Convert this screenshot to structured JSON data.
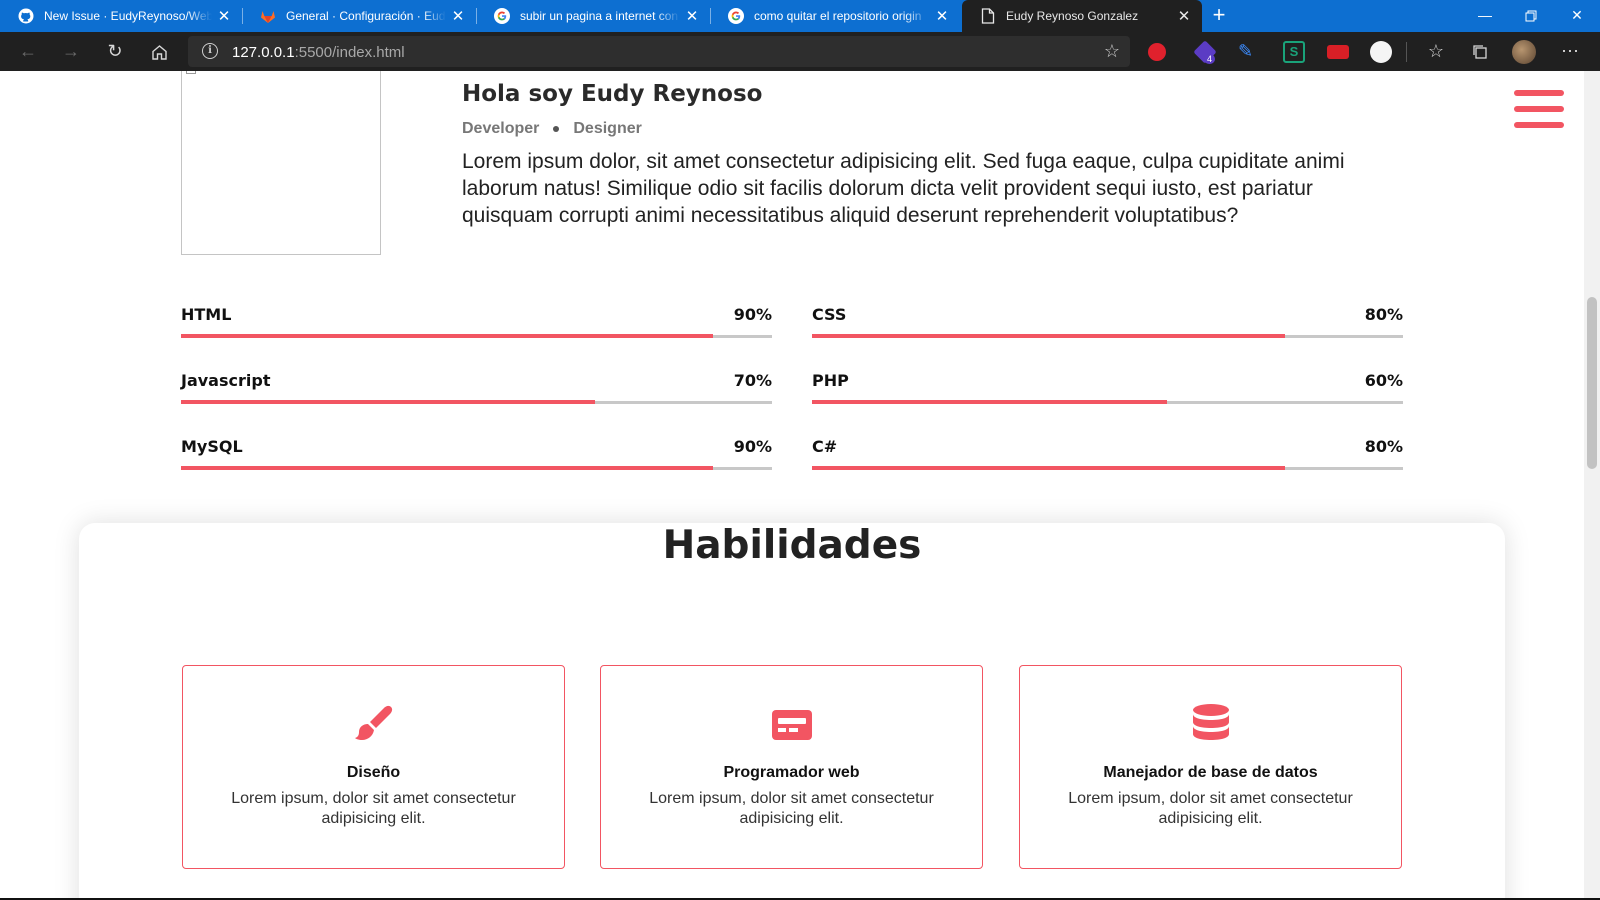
{
  "browser": {
    "tabs": [
      {
        "title": "New Issue · EudyReynoso/Web-p",
        "icon": "github-icon",
        "active": false
      },
      {
        "title": "General · Configuración · Eudy Re",
        "icon": "gitlab-icon",
        "active": false
      },
      {
        "title": "subir un pagina a internet con gi",
        "icon": "google-icon",
        "active": false
      },
      {
        "title": "como quitar el repositorio origin",
        "icon": "google-icon",
        "active": false
      },
      {
        "title": "Eudy Reynoso Gonzalez",
        "icon": "page-icon",
        "active": true
      }
    ],
    "address": {
      "host": "127.0.0.1",
      "rest": ":5500/index.html"
    },
    "extension_badge": "4",
    "colors": {
      "titlebar": "#0d6fd1",
      "toolbar": "#202020"
    }
  },
  "profile": {
    "greeting": "Hola soy Eudy Reynoso",
    "roles": [
      "Developer",
      "Designer"
    ],
    "intro": "Lorem ipsum dolor, sit amet consectetur adipisicing elit. Sed fuga eaque, culpa cupiditate animi laborum natus! Similique odio sit facilis dolorum dicta velit provident sequi iusto, est pariatur quisquam corrupti animi necessitatibus aliquid deserunt reprehenderit voluptatibus?"
  },
  "skills": [
    {
      "name": "HTML",
      "percent_label": "90%",
      "level": 0.9
    },
    {
      "name": "CSS",
      "percent_label": "80%",
      "level": 0.8
    },
    {
      "name": "Javascript",
      "percent_label": "70%",
      "level": 0.7
    },
    {
      "name": "PHP",
      "percent_label": "60%",
      "level": 0.6
    },
    {
      "name": "MySQL",
      "percent_label": "90%",
      "level": 0.9
    },
    {
      "name": "C#",
      "percent_label": "80%",
      "level": 0.8
    }
  ],
  "habilidades": {
    "title": "Habilidades",
    "cards": [
      {
        "icon": "paint-brush-icon",
        "title": "Diseño",
        "text": "Lorem ipsum, dolor sit amet consectetur adipisicing elit."
      },
      {
        "icon": "credit-card-icon",
        "title": "Programador web",
        "text": "Lorem ipsum, dolor sit amet consectetur adipisicing elit."
      },
      {
        "icon": "database-icon",
        "title": "Manejador de base de datos",
        "text": "Lorem ipsum, dolor sit amet consectetur adipisicing elit."
      }
    ]
  },
  "colors": {
    "accent": "#f25562",
    "track": "#c8c8c8"
  }
}
